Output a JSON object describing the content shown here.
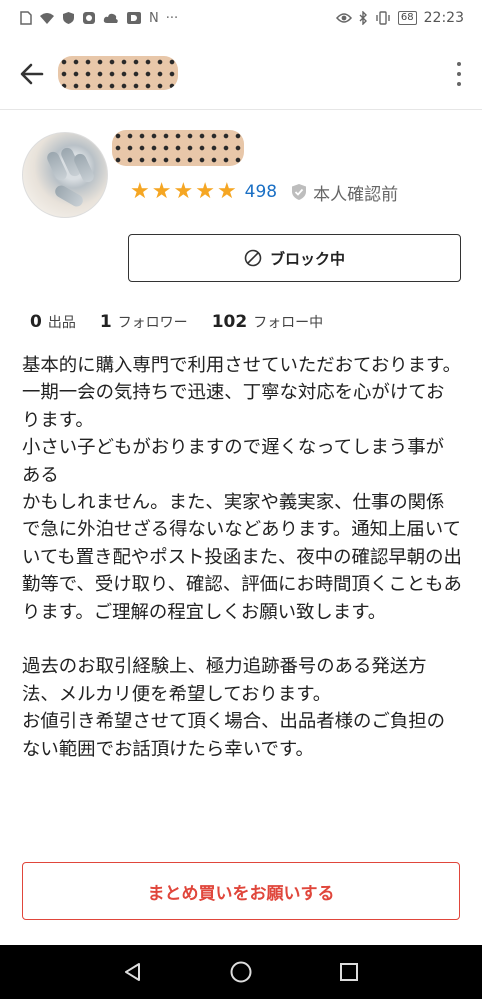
{
  "status_bar": {
    "left_icons": [
      "sim-icon",
      "wifi-icon",
      "shield-icon",
      "app-icon",
      "cloud-icon",
      "game-icon",
      "n-icon",
      "more-icon"
    ],
    "time": "22:23",
    "battery": "68",
    "notification_letter": "N",
    "more": "···"
  },
  "header": {
    "back_icon": "arrow-left-icon",
    "menu_icon": "more-vertical-icon"
  },
  "profile": {
    "rating_count": "498",
    "stars": 5,
    "verification_status": "本人確認前"
  },
  "actions": {
    "block_label": "ブロック中",
    "bundle_purchase_label": "まとめ買いをお願いする"
  },
  "stats": {
    "listings_count": "0",
    "listings_label": "出品",
    "followers_count": "1",
    "followers_label": "フォロワー",
    "following_count": "102",
    "following_label": "フォロー中"
  },
  "bio": "基本的に購入専門で利用させていただおております。\n一期一会の気持ちで迅速、丁寧な対応を心がけております。\n小さい子どもがおりますので遅くなってしまう事がある\nかもしれません。また、実家や義実家、仕事の関係で急に外泊せざる得ないなどあります。通知上届いていても置き配やポスト投函また、夜中の確認早朝の出勤等で、受け取り、確認、評価にお時間頂くこともあります。ご理解の程宜しくお願い致します。\n\n過去のお取引経験上、極力追跡番号のある発送方法、メルカリ便を希望しております。\nお値引き希望させて頂く場合、出品者様のご負担のない範囲でお話頂けたら幸いです。",
  "colors": {
    "star": "#f5a623",
    "link_blue": "#1a6fc4",
    "cta_red": "#e0463b"
  }
}
